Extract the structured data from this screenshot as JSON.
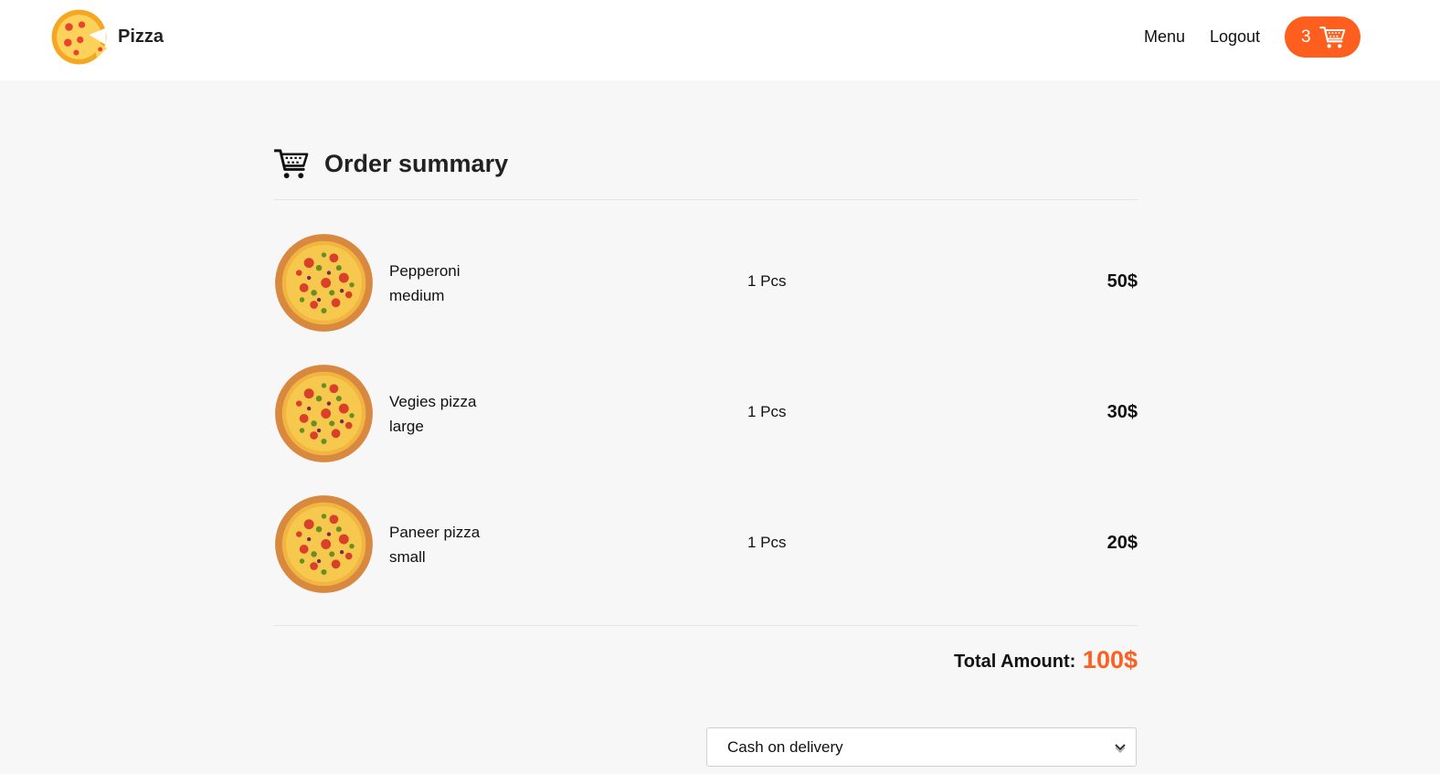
{
  "header": {
    "brand": "Pizza",
    "nav": {
      "menu": "Menu",
      "logout": "Logout"
    },
    "cart": {
      "count": "3",
      "icon": "cart-icon"
    },
    "accent_color": "#fe5f1e"
  },
  "summary": {
    "title": "Order summary",
    "icon": "cart-icon",
    "items": [
      {
        "name": "Pepperoni",
        "size": "medium",
        "qty": "1 Pcs",
        "price": "50$",
        "image": "pizza-image"
      },
      {
        "name": "Vegies pizza",
        "size": "large",
        "qty": "1 Pcs",
        "price": "30$",
        "image": "pizza-image"
      },
      {
        "name": "Paneer pizza",
        "size": "small",
        "qty": "1 Pcs",
        "price": "20$",
        "image": "pizza-image"
      }
    ],
    "total_label": "Total Amount:",
    "total_value": "100$"
  },
  "payment": {
    "selected": "Cash on delivery"
  }
}
